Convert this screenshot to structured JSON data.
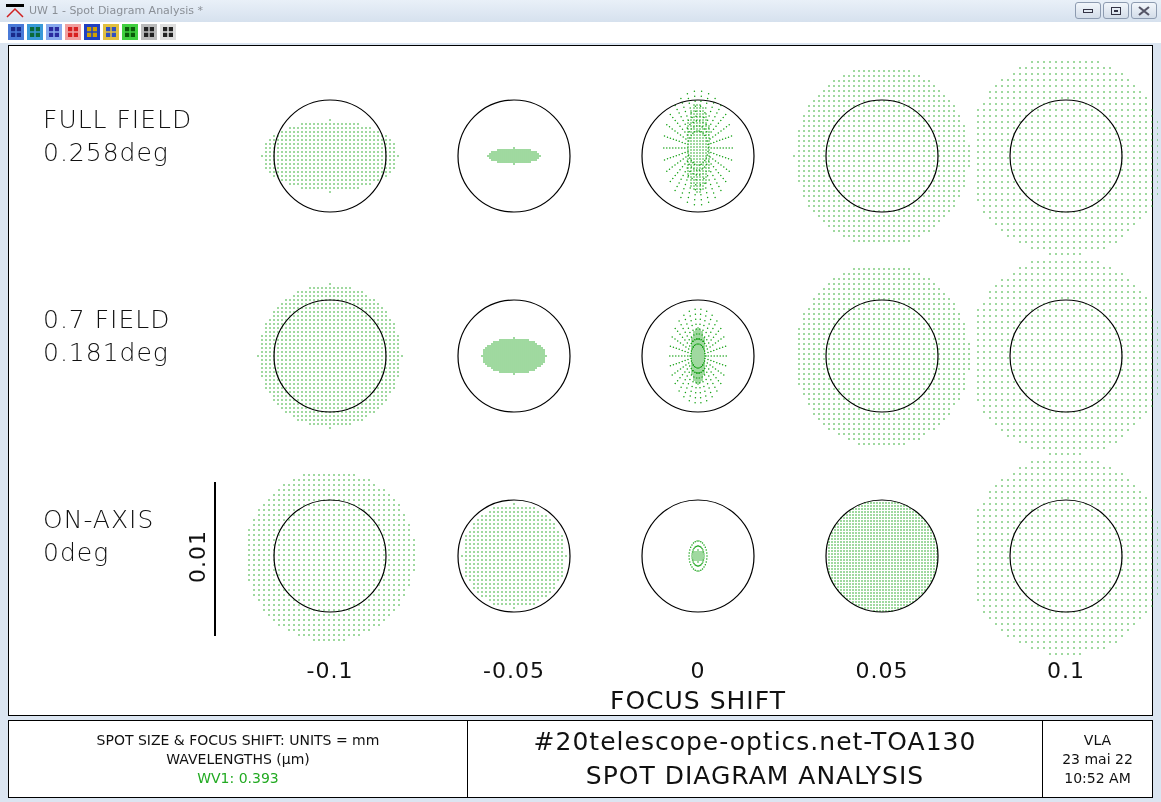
{
  "window": {
    "title": "UW 1 - Spot Diagram Analysis *"
  },
  "plot": {
    "rows": [
      {
        "label": "FULL FIELD",
        "angle": "0.258deg"
      },
      {
        "label": "0.7 FIELD",
        "angle": "0.181deg"
      },
      {
        "label": "ON-AXIS",
        "angle": "0deg"
      }
    ],
    "scale_label": "0.01",
    "columns": [
      "-0.1",
      "-0.05",
      "0",
      "0.05",
      "0.1"
    ],
    "xlabel": "FOCUS SHIFT"
  },
  "info": {
    "units": "SPOT SIZE & FOCUS SHIFT: UNITS = mm",
    "wavelengths": "WAVELENGTHS (μm)",
    "wavelength_items": [
      {
        "label": "WV1: 0.393",
        "color": "#22aa22"
      }
    ],
    "title": "#20telescope-optics.net-TOA130",
    "subtitle": "SPOT DIAGRAM ANALYSIS",
    "author": "VLA",
    "date": "23 mai 22",
    "time": "10:52 AM"
  }
}
